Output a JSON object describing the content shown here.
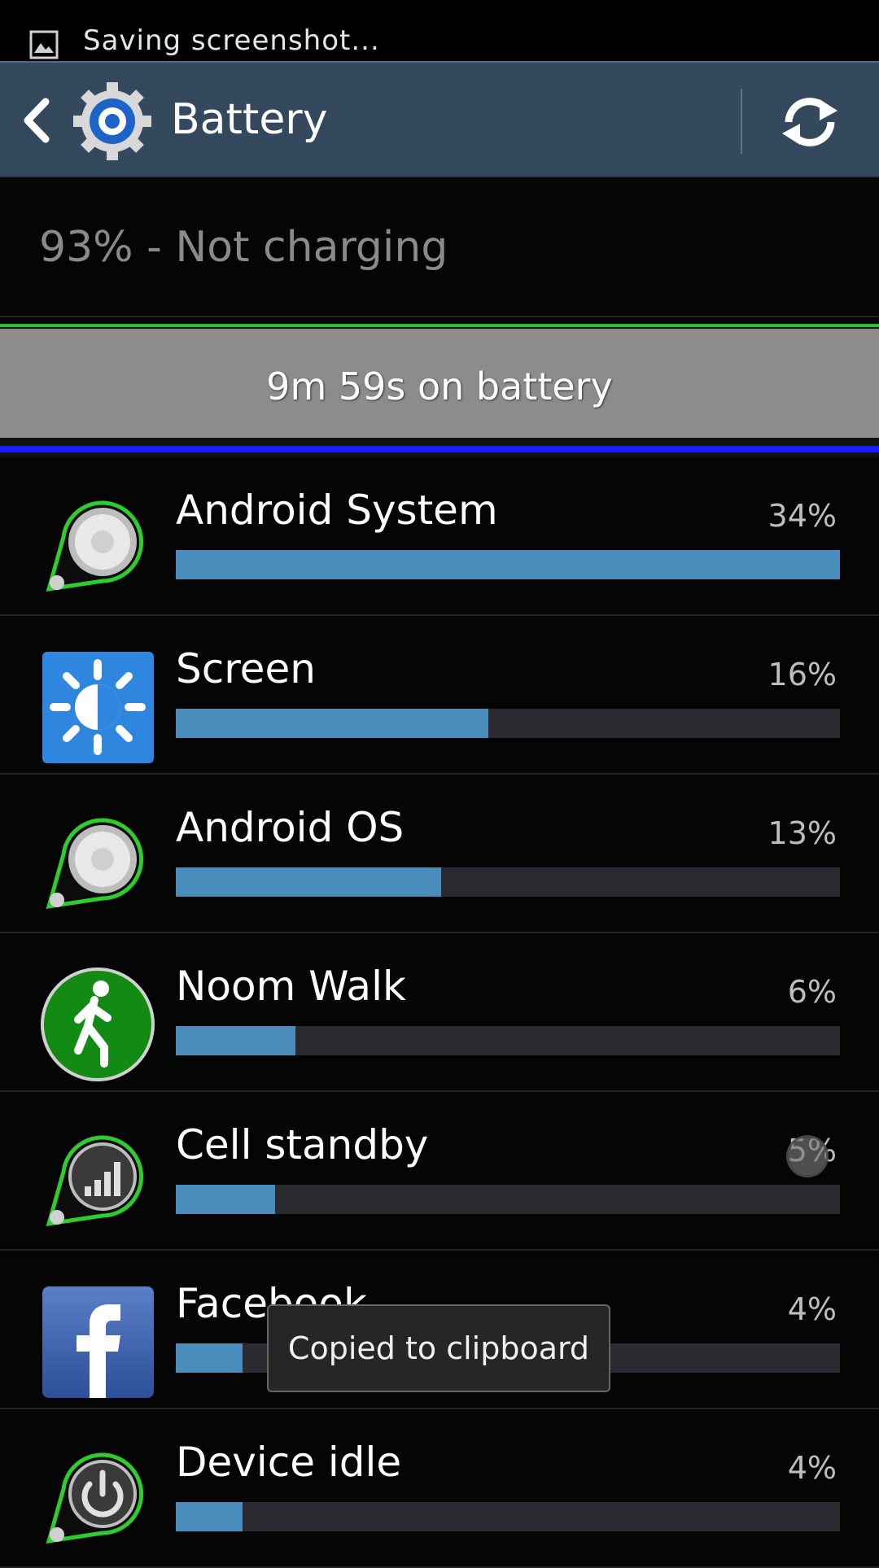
{
  "status_bar": {
    "notification": "Saving screenshot..."
  },
  "action_bar": {
    "title": "Battery"
  },
  "battery": {
    "status": "93% - Not charging",
    "graph_label": "9m 59s on battery"
  },
  "colors": {
    "action_bar": "#34495e",
    "bar_fill": "#4a8cbc",
    "bar_track": "#2a2a30",
    "graph_gray": "#8c8c8c",
    "graph_green": "#2fbf2f",
    "graph_blue": "#1a1aff"
  },
  "items": [
    {
      "name": "Android System",
      "percent": "34%",
      "level": 1.0,
      "icon": "android-system-icon"
    },
    {
      "name": "Screen",
      "percent": "16%",
      "level": 0.47,
      "icon": "brightness-icon"
    },
    {
      "name": "Android OS",
      "percent": "13%",
      "level": 0.4,
      "icon": "android-os-icon"
    },
    {
      "name": "Noom Walk",
      "percent": "6%",
      "level": 0.18,
      "icon": "walking-man-icon"
    },
    {
      "name": "Cell standby",
      "percent": "5%",
      "level": 0.15,
      "icon": "signal-bars-icon"
    },
    {
      "name": "Facebook",
      "percent": "4%",
      "level": 0.1,
      "icon": "facebook-icon"
    },
    {
      "name": "Device idle",
      "percent": "4%",
      "level": 0.1,
      "icon": "power-icon"
    }
  ],
  "toast": {
    "message": "Copied to clipboard"
  }
}
